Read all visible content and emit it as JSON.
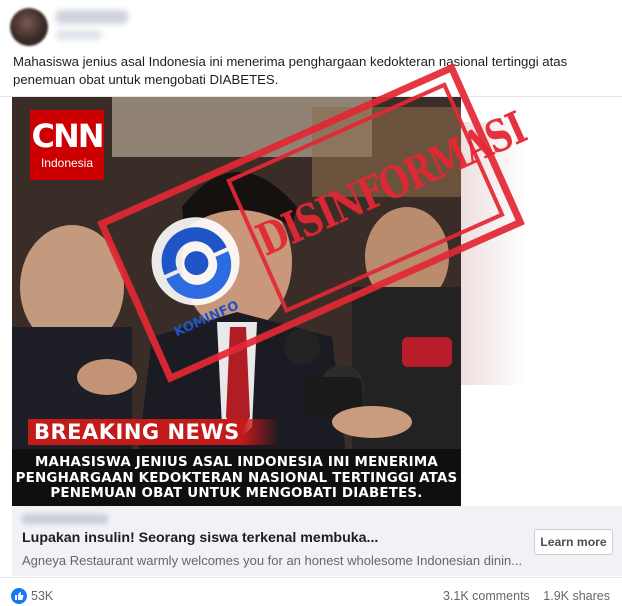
{
  "post": {
    "text": "Mahasiswa jenius asal Indonesia ini menerima penghargaan kedokteran nasional tertinggi atas penemuan obat untuk mengobati DIABETES."
  },
  "image": {
    "brand": "CNN",
    "brand_sub": "Indonesia",
    "breaking": "BREAKING NEWS",
    "caption_lines": [
      "MAHASISWA JENIUS ASAL INDONESIA INI MENERIMA",
      "PENGHARGAAN KEDOKTERAN NASIONAL TERTINGGI ATAS",
      "PENEMUAN OBAT UNTUK MENGOBATI DIABETES."
    ],
    "stamp_text": "DISINFORMASI",
    "stamp_logo_text": "KOMINFO",
    "colors": {
      "stamp": "#e22834",
      "cnn_red": "#cc0000",
      "kominfo_blue": "#1f55c6"
    }
  },
  "link": {
    "title": "Lupakan insulin! Seorang siswa terkenal membuka...",
    "description": "Agneya Restaurant warmly welcomes you for an honest wholesome Indonesian dinin...",
    "button": "Learn more"
  },
  "footer": {
    "reaction_icon": "like-icon",
    "reactions": "53K",
    "comments": "3.1K comments",
    "shares": "1.9K shares"
  }
}
